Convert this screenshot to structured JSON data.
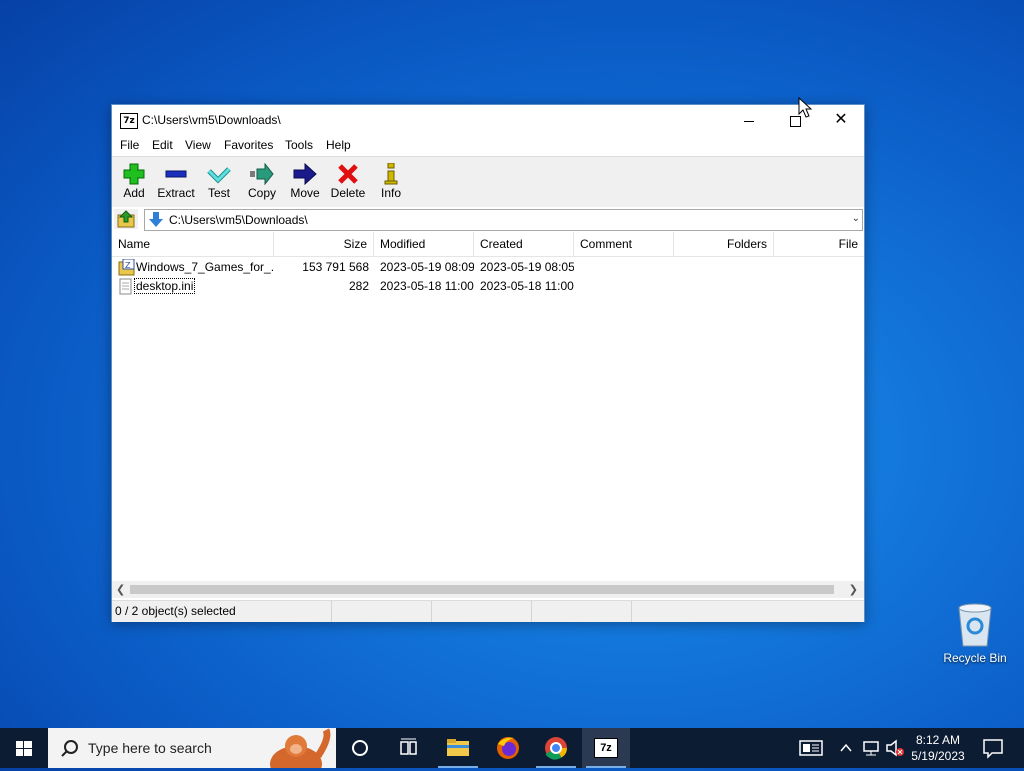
{
  "window": {
    "title": "C:\\Users\\vm5\\Downloads\\",
    "app_icon_text": "7z",
    "controls": {
      "minimize": "minimize",
      "maximize": "maximize",
      "close": "✕"
    }
  },
  "menu": [
    "File",
    "Edit",
    "View",
    "Favorites",
    "Tools",
    "Help"
  ],
  "toolbar": [
    {
      "label": "Add",
      "icon": "plus-icon",
      "color": "#1fbf1f"
    },
    {
      "label": "Extract",
      "icon": "minus-icon",
      "color": "#1b2fbf"
    },
    {
      "label": "Test",
      "icon": "check-icon",
      "color": "#34c9c9"
    },
    {
      "label": "Copy",
      "icon": "copy-arrow-icon",
      "color": "#2a9a7c"
    },
    {
      "label": "Move",
      "icon": "move-arrow-icon",
      "color": "#1a1a8c"
    },
    {
      "label": "Delete",
      "icon": "delete-x-icon",
      "color": "#e01010"
    },
    {
      "label": "Info",
      "icon": "info-icon",
      "color": "#d0b800"
    }
  ],
  "address": {
    "path": "C:\\Users\\vm5\\Downloads\\"
  },
  "columns": [
    "Name",
    "Size",
    "Modified",
    "Created",
    "Comment",
    "Folders",
    "File"
  ],
  "files": [
    {
      "name": "Windows_7_Games_for_...",
      "size": "153 791 568",
      "modified": "2023-05-19 08:09",
      "created": "2023-05-19 08:05",
      "icon": "zip-archive-icon"
    },
    {
      "name": "desktop.ini",
      "size": "282",
      "modified": "2023-05-18 11:00",
      "created": "2023-05-18 11:00",
      "icon": "ini-file-icon"
    }
  ],
  "status": {
    "selection": "0 / 2 object(s) selected"
  },
  "desktop": {
    "recycle_bin_label": "Recycle Bin"
  },
  "taskbar": {
    "search_placeholder": "Type here to search",
    "time": "8:12 AM",
    "date": "5/19/2023",
    "active_app_label": "7z"
  }
}
